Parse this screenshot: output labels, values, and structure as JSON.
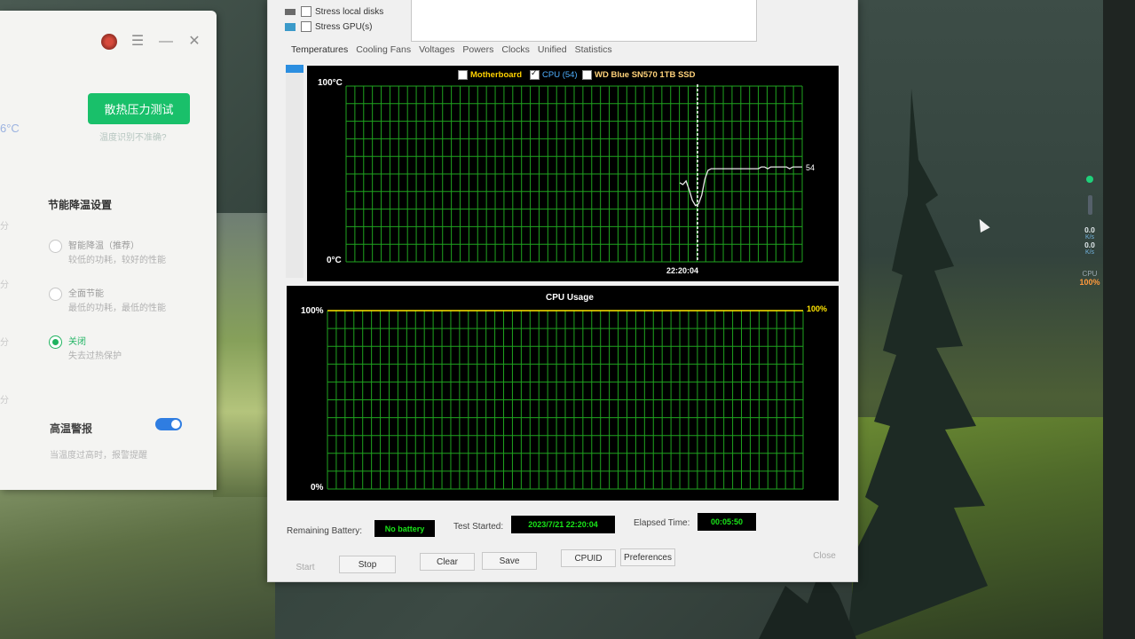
{
  "app_panel": {
    "stress_button": "散热压力测试",
    "hint": "温度识别不准确?",
    "temp_partial": "6°C",
    "section_title": "节能降温设置",
    "options": [
      {
        "title": "智能降温（推荐）",
        "sub": "较低的功耗，较好的性能",
        "selected": false
      },
      {
        "title": "全面节能",
        "sub": "最低的功耗，最低的性能",
        "selected": false
      },
      {
        "title": "关闭",
        "sub": "失去过热保护",
        "selected": true
      }
    ],
    "fen_label": "分",
    "alarm_title": "高温警报",
    "alarm_sub": "当温度过高时，报警提醒",
    "alarm_enabled": true,
    "icons": [
      "avatar-icon",
      "menu-icon",
      "minimize-icon",
      "close-icon"
    ]
  },
  "aida": {
    "checks": [
      {
        "label": "Stress local disks",
        "checked": false
      },
      {
        "label": "Stress GPU(s)",
        "checked": false
      }
    ],
    "tabs": [
      "Temperatures",
      "Cooling Fans",
      "Voltages",
      "Powers",
      "Clocks",
      "Unified",
      "Statistics"
    ],
    "active_tab": "Temperatures",
    "status": {
      "battery_label": "Remaining Battery:",
      "battery_value": "No battery",
      "started_label": "Test Started:",
      "started_value": "2023/7/21 22:20:04",
      "elapsed_label": "Elapsed Time:",
      "elapsed_value": "00:05:50"
    },
    "buttons": {
      "start": "Start",
      "stop": "Stop",
      "clear": "Clear",
      "save": "Save",
      "cpuid": "CPUID",
      "preferences": "Preferences",
      "close": "Close"
    }
  },
  "chart_data": [
    {
      "type": "line",
      "legend": [
        {
          "name": "Motherboard",
          "checked": false,
          "color": "#ffd200"
        },
        {
          "name": "CPU (54)",
          "checked": true,
          "color": "#4fb0ff"
        },
        {
          "name": "WD Blue SN570 1TB SSD",
          "checked": false,
          "color": "#ffd27a"
        }
      ],
      "ymax_label": "100°C",
      "ymin_label": "0°C",
      "ylim": [
        0,
        100
      ],
      "marker_time": "22:20:04",
      "last_value_label": "54",
      "series": [
        {
          "name": "CPU (54)",
          "color": "#e8e8e8",
          "values": [
            45,
            44,
            46,
            41,
            35,
            32,
            33,
            38,
            47,
            52,
            53,
            53,
            53,
            53,
            53,
            53,
            53,
            53,
            53,
            53,
            53,
            53,
            53,
            53,
            53,
            53,
            54,
            54,
            53,
            54,
            54,
            54,
            54,
            54,
            54,
            53,
            54,
            54,
            54,
            54
          ]
        }
      ]
    },
    {
      "type": "line",
      "title": "CPU Usage",
      "ymax_label": "100%",
      "ymin_label": "0%",
      "ylim": [
        0,
        100
      ],
      "last_value_label": "100%",
      "series": [
        {
          "name": "CPU Usage",
          "color": "#ffe500",
          "values": [
            100,
            100
          ]
        }
      ]
    }
  ],
  "tray": {
    "up_value": "0.0",
    "up_unit": "K/s",
    "down_value": "0.0",
    "down_unit": "K/s",
    "cpu_label": "CPU",
    "cpu_value": "100%"
  }
}
